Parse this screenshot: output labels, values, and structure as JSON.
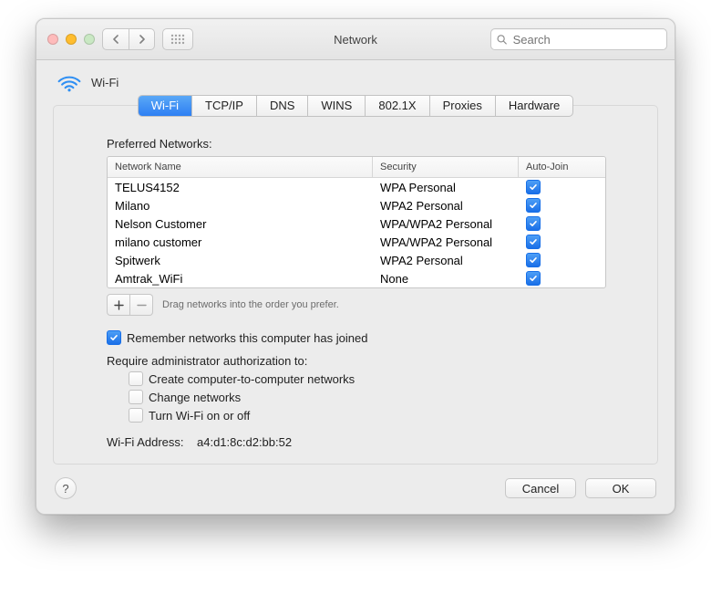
{
  "window": {
    "title": "Network",
    "search_placeholder": "Search"
  },
  "header": {
    "label": "Wi-Fi"
  },
  "tabs": [
    {
      "label": "Wi-Fi",
      "active": true
    },
    {
      "label": "TCP/IP",
      "active": false
    },
    {
      "label": "DNS",
      "active": false
    },
    {
      "label": "WINS",
      "active": false
    },
    {
      "label": "802.1X",
      "active": false
    },
    {
      "label": "Proxies",
      "active": false
    },
    {
      "label": "Hardware",
      "active": false
    }
  ],
  "preferred_networks": {
    "title": "Preferred Networks:",
    "columns": {
      "name": "Network Name",
      "security": "Security",
      "autojoin": "Auto-Join"
    },
    "rows": [
      {
        "name": "TELUS4152",
        "security": "WPA Personal",
        "autojoin": true
      },
      {
        "name": "Milano",
        "security": "WPA2 Personal",
        "autojoin": true
      },
      {
        "name": "Nelson Customer",
        "security": "WPA/WPA2 Personal",
        "autojoin": true
      },
      {
        "name": "milano customer",
        "security": "WPA/WPA2 Personal",
        "autojoin": true
      },
      {
        "name": "Spitwerk",
        "security": "WPA2 Personal",
        "autojoin": true
      },
      {
        "name": "Amtrak_WiFi",
        "security": "None",
        "autojoin": true
      }
    ],
    "hint": "Drag networks into the order you prefer."
  },
  "options": {
    "remember": {
      "label": "Remember networks this computer has joined",
      "checked": true
    },
    "require_admin_label": "Require administrator authorization to:",
    "admin": [
      {
        "label": "Create computer-to-computer networks",
        "checked": false
      },
      {
        "label": "Change networks",
        "checked": false
      },
      {
        "label": "Turn Wi-Fi on or off",
        "checked": false
      }
    ]
  },
  "wifi_address": {
    "label": "Wi-Fi Address:",
    "value": "a4:d1:8c:d2:bb:52"
  },
  "buttons": {
    "cancel": "Cancel",
    "ok": "OK"
  }
}
